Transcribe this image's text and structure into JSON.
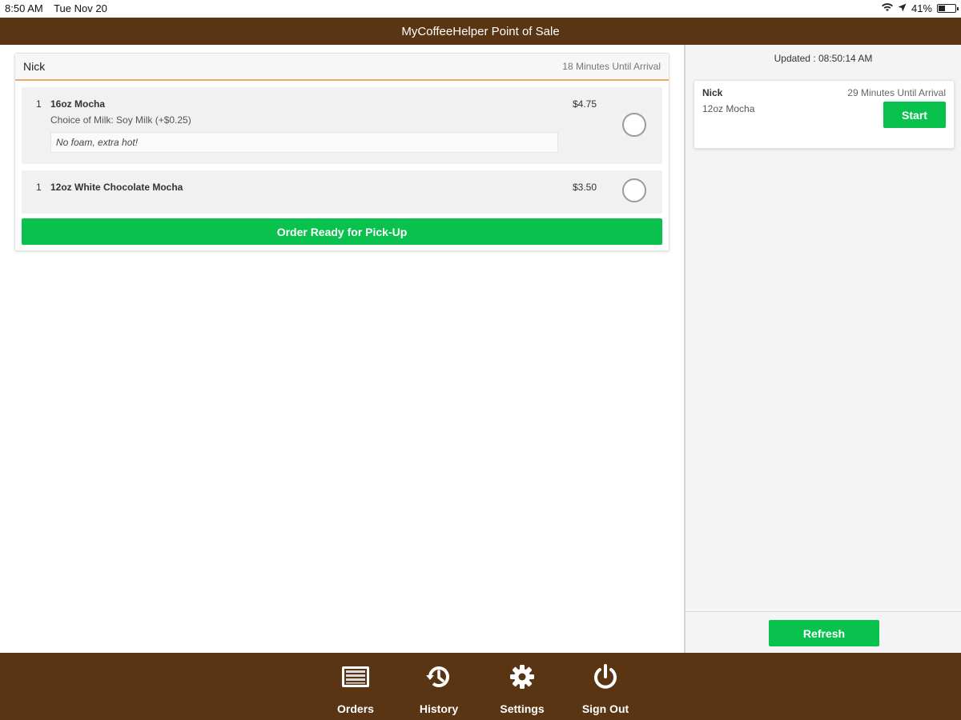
{
  "colors": {
    "brand_brown": "#5a3513",
    "accent_green": "#08c24d",
    "header_underline": "#f3a86a"
  },
  "status_bar": {
    "time": "8:50 AM",
    "date": "Tue Nov 20",
    "battery": "41%",
    "battery_level": 0.41,
    "icons": [
      "wifi-icon",
      "location-icon",
      "battery-icon"
    ]
  },
  "app": {
    "title": "MyCoffeeHelper Point of Sale"
  },
  "current_order": {
    "customer": "Nick",
    "eta": "18 Minutes Until Arrival",
    "items": [
      {
        "qty": "1",
        "name": "16oz Mocha",
        "option": "Choice of Milk: Soy Milk (+$0.25)",
        "note": "No foam, extra hot!",
        "price": "$4.75"
      },
      {
        "qty": "1",
        "name": "12oz White Chocolate Mocha",
        "price": "$3.50"
      }
    ],
    "ready_button": "Order Ready for Pick-Up"
  },
  "queue": {
    "updated": "Updated : 08:50:14 AM",
    "orders": [
      {
        "customer": "Nick",
        "eta": "29 Minutes Until Arrival",
        "item": "12oz Mocha",
        "action": "Start"
      }
    ],
    "refresh_button": "Refresh"
  },
  "tabs": [
    {
      "label": "Orders",
      "icon": "orders-icon"
    },
    {
      "label": "History",
      "icon": "history-icon"
    },
    {
      "label": "Settings",
      "icon": "gear-icon"
    },
    {
      "label": "Sign Out",
      "icon": "power-icon"
    }
  ]
}
